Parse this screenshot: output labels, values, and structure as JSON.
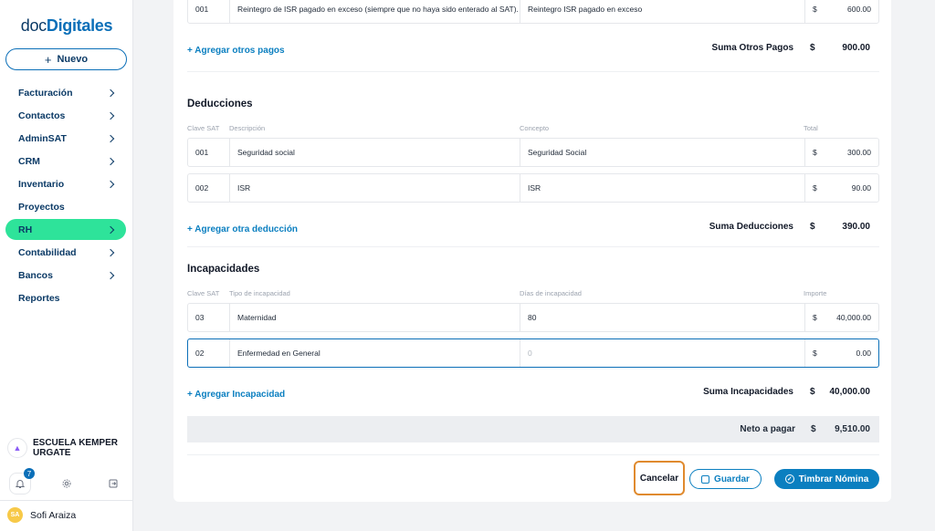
{
  "brand": {
    "part1": "doc",
    "part2": "Digitales"
  },
  "sidebar": {
    "new_label": "Nuevo",
    "items": [
      {
        "label": "Facturación",
        "chevron": true
      },
      {
        "label": "Contactos",
        "chevron": true
      },
      {
        "label": "AdminSAT",
        "chevron": true
      },
      {
        "label": "CRM",
        "chevron": true
      },
      {
        "label": "Inventario",
        "chevron": true
      },
      {
        "label": "Proyectos",
        "chevron": false
      },
      {
        "label": "RH",
        "chevron": true,
        "active": true
      },
      {
        "label": "Contabilidad",
        "chevron": true
      },
      {
        "label": "Bancos",
        "chevron": true
      },
      {
        "label": "Reportes",
        "chevron": false
      }
    ],
    "org_name_line1": "ESCUELA KEMPER",
    "org_name_line2": "URGATE",
    "notifications_count": "7",
    "user_initials": "SA",
    "user_name": "Sofi Araiza"
  },
  "otros_pagos": {
    "row": {
      "clave": "001",
      "descripcion": "Reintegro de ISR pagado en exceso (siempre que no haya sido enterado al SAT).",
      "concepto": "Reintegro ISR pagado en exceso",
      "currency": "$",
      "total": "600.00"
    },
    "add_label": "+ Agregar otros pagos",
    "sum_label": "Suma Otros Pagos",
    "sum_currency": "$",
    "sum_value": "900.00"
  },
  "deducciones": {
    "title": "Deducciones",
    "headers": {
      "clave": "Clave SAT",
      "descripcion": "Descripción",
      "concepto": "Concepto",
      "total": "Total"
    },
    "rows": [
      {
        "clave": "001",
        "descripcion": "Seguridad social",
        "concepto": "Seguridad Social",
        "currency": "$",
        "total": "300.00"
      },
      {
        "clave": "002",
        "descripcion": "ISR",
        "concepto": "ISR",
        "currency": "$",
        "total": "90.00"
      }
    ],
    "add_label": "+ Agregar otra deducción",
    "sum_label": "Suma Deducciones",
    "sum_currency": "$",
    "sum_value": "390.00"
  },
  "incapacidades": {
    "title": "Incapacidades",
    "headers": {
      "clave": "Clave SAT",
      "tipo": "Tipo de incapacidad",
      "dias": "Días de incapacidad",
      "importe": "Importe"
    },
    "rows": [
      {
        "clave": "03",
        "tipo": "Maternidad",
        "dias": "80",
        "currency": "$",
        "importe": "40,000.00"
      },
      {
        "clave": "02",
        "tipo": "Enfermedad en General",
        "dias_placeholder": "0",
        "currency": "$",
        "importe": "0.00"
      }
    ],
    "add_label": "+ Agregar Incapacidad",
    "sum_label": "Suma Incapacidades",
    "sum_currency": "$",
    "sum_value": "40,000.00"
  },
  "neto": {
    "label": "Neto a pagar",
    "currency": "$",
    "value": "9,510.00"
  },
  "actions": {
    "cancel": "Cancelar",
    "save": "Guardar",
    "timbrar": "Timbrar Nómina"
  },
  "colors": {
    "accent": "#0b7fc0",
    "active_nav": "#2ee39a",
    "highlight_border": "#e08a2e"
  }
}
